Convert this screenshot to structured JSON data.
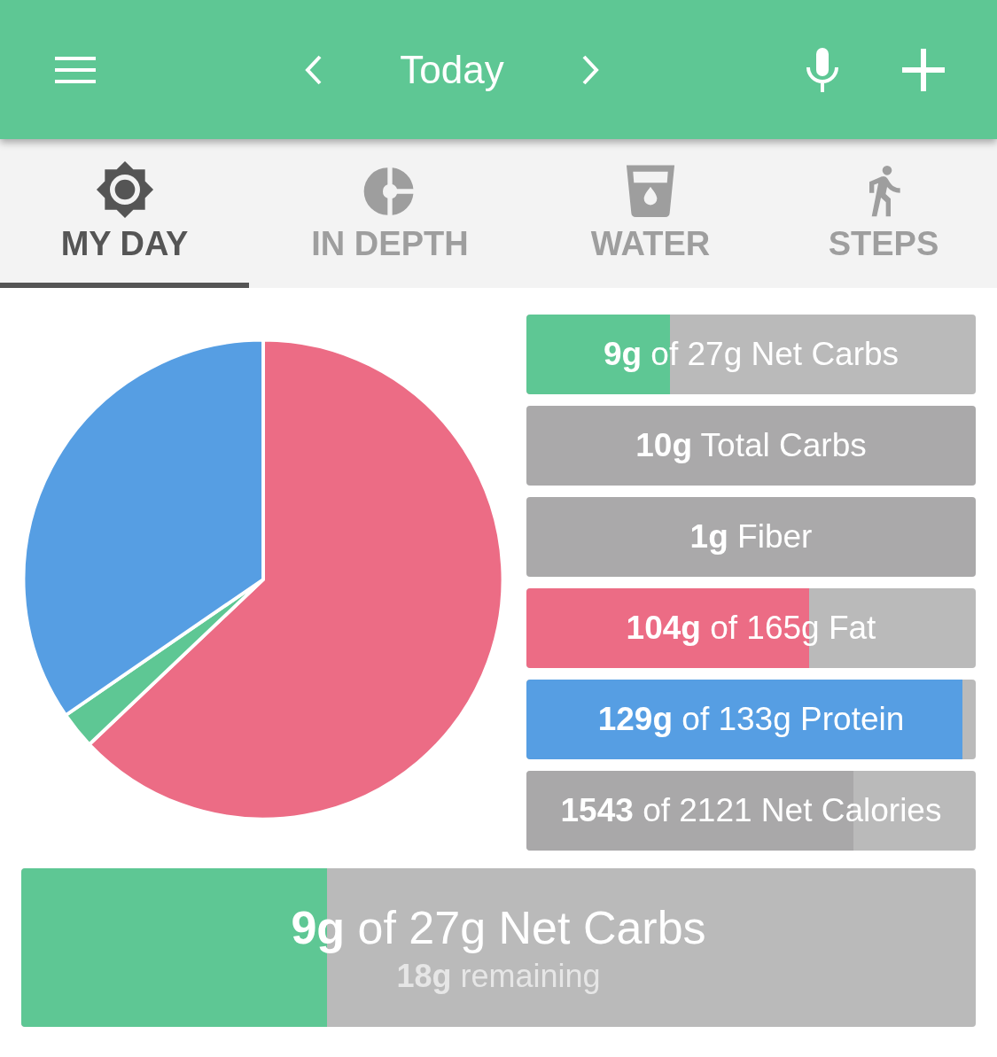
{
  "app_bar": {
    "title": "Today"
  },
  "tabs": [
    {
      "label": "MY DAY",
      "selected": true
    },
    {
      "label": "IN DEPTH",
      "selected": false
    },
    {
      "label": "WATER",
      "selected": false
    },
    {
      "label": "STEPS",
      "selected": false
    }
  ],
  "nutrient_bars": [
    {
      "kind": "progress",
      "text": "**9g** of 27g Net Carbs",
      "level": 0.32,
      "color": "#5ec794"
    },
    {
      "kind": "plain",
      "text": "**10g** Total Carbs"
    },
    {
      "kind": "plain",
      "text": "**1g** Fiber"
    },
    {
      "kind": "progress",
      "text": "**104g** of 165g Fat",
      "level": 0.63,
      "color": "#ec6c85"
    },
    {
      "kind": "progress",
      "text": "**129g** of 133g Protein",
      "level": 0.97,
      "color": "#569ee3"
    },
    {
      "kind": "progress",
      "text": "**1543** of 2121 Net Calories",
      "level": 0.727,
      "color": "#a9a8a9"
    }
  ],
  "summary_bar": {
    "text": "**9g** of 27g Net Carbs",
    "subtext": "**18g** remaining",
    "level": 0.32
  }
}
